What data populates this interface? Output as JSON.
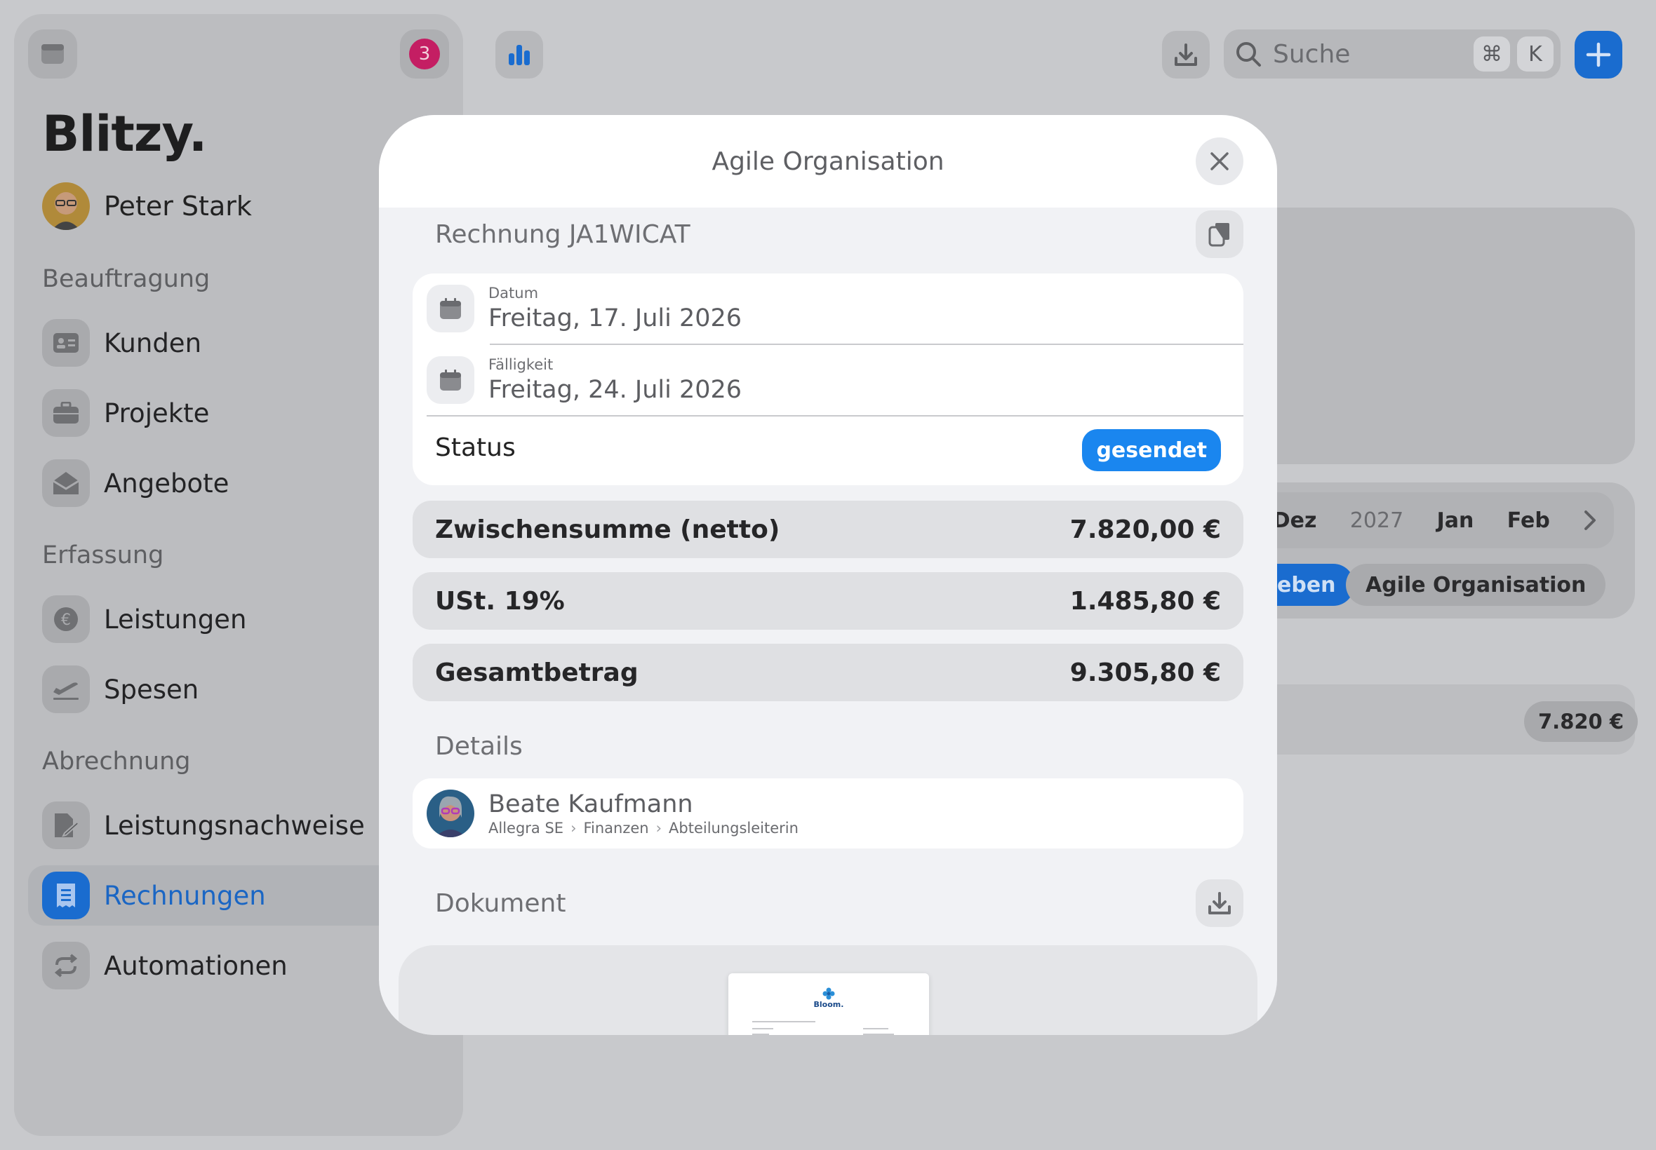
{
  "sidebar": {
    "notification_count": "3",
    "brand": "Blitzy.",
    "user_name": "Peter Stark",
    "sections": {
      "beauftragung": "Beauftragung",
      "erfassung": "Erfassung",
      "abrechnung": "Abrechnung"
    },
    "items": {
      "kunden": "Kunden",
      "projekte": "Projekte",
      "angebote": "Angebote",
      "leistungen": "Leistungen",
      "spesen": "Spesen",
      "leistungsnachweise": "Leistungsnachweise",
      "rechnungen": "Rechnungen",
      "automationen": "Automationen"
    }
  },
  "topbar": {
    "search_placeholder": "Suche",
    "kbd_cmd": "⌘",
    "kbd_k": "K"
  },
  "background": {
    "months": [
      "Dez",
      "2027",
      "Jan",
      "Feb"
    ],
    "chip_active": "eben",
    "chip_org": "Agile Organisation",
    "amount": "7.820 €"
  },
  "modal": {
    "title": "Agile Organisation",
    "invoice_heading": "Rechnung JA1WICAT",
    "date_label": "Datum",
    "date_value": "Freitag, 17. Juli 2026",
    "due_label": "Fälligkeit",
    "due_value": "Freitag, 24. Juli 2026",
    "status_label": "Status",
    "status_value": "gesendet",
    "subtotal_label": "Zwischensumme (netto)",
    "subtotal_value": "7.820,00 €",
    "vat_label": "USt. 19%",
    "vat_value": "1.485,80 €",
    "total_label": "Gesamtbetrag",
    "total_value": "9.305,80 €",
    "details_heading": "Details",
    "contact_name": "Beate Kaufmann",
    "contact_company": "Allegra SE",
    "contact_department": "Finanzen",
    "contact_role": "Abteilungsleiterin",
    "document_heading": "Dokument",
    "doc_brand": "Bloom."
  },
  "colors": {
    "accent": "#1a6ccf",
    "status_badge": "#1a86ef",
    "notification": "#c41e63"
  }
}
